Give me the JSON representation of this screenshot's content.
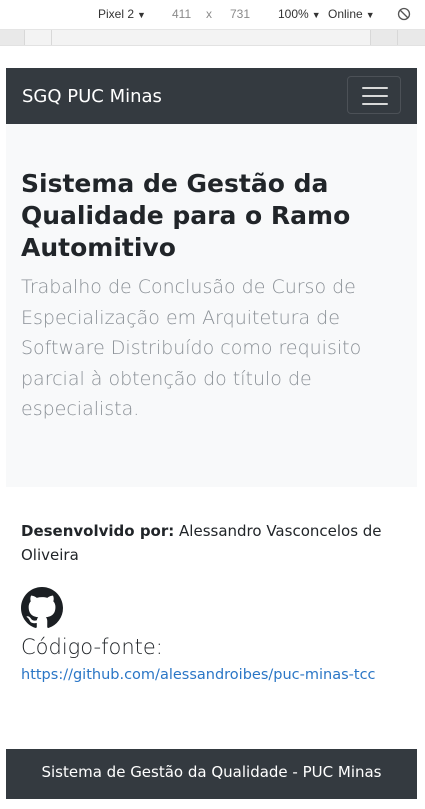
{
  "devtools": {
    "device": "Pixel 2",
    "width": "411",
    "separator": "x",
    "height": "731",
    "zoom": "100%",
    "network": "Online",
    "dropdown_glyph": "▼"
  },
  "navbar": {
    "brand": "SGQ PUC Minas",
    "toggle_icon": "hamburger-icon"
  },
  "jumbotron": {
    "title": "Sistema de Gestão da Qualidade para o Ramo Automitivo",
    "lead": "Trabalho de Conclusão de Curso de Especialização em Arquitetura de Software Distribuído como requisito parcial à obtenção do título de especialista."
  },
  "content": {
    "developed_by_label": "Desenvolvido por:",
    "developer_name": "Alessandro Vasconcelos de Oliveira",
    "github_icon": "github-icon",
    "source_title": "Código-fonte:",
    "repo_url": "https://github.com/alessandroibes/puc-minas-tcc"
  },
  "footer": {
    "text": "Sistema de Gestão da Qualidade - PUC Minas"
  },
  "colors": {
    "navbar_bg": "#343a40",
    "jumbotron_bg": "#f8f9fa",
    "link": "#2a76c6",
    "lead_text": "#8a9096"
  }
}
